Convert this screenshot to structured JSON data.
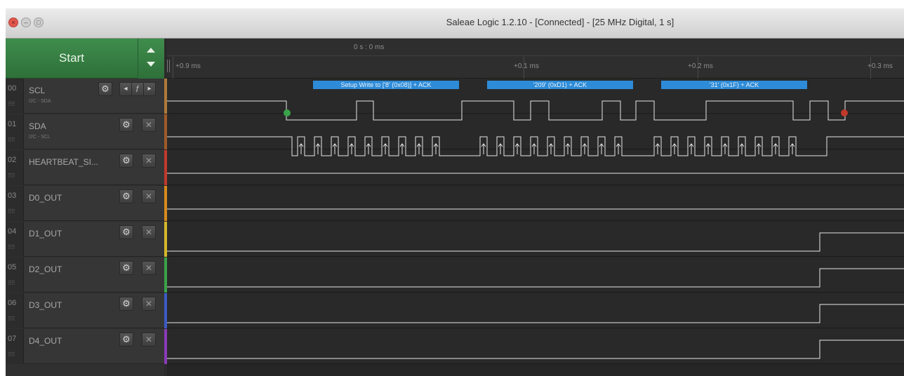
{
  "window": {
    "title": "Saleae Logic 1.2.10 - [Connected] - [25 MHz Digital, 1 s]",
    "close_glyph": "×",
    "min_glyph": "–",
    "zoom_glyph": "□"
  },
  "panel": {
    "start_label": "Start",
    "channels": [
      {
        "num": "00",
        "name": "SCL",
        "sub": "I2C - SDA",
        "color": "#b07a3a",
        "nav": [
          "◂",
          "ƒ",
          "▸"
        ]
      },
      {
        "num": "01",
        "name": "SDA",
        "sub": "I2C - SCL",
        "color": "#a05a28"
      },
      {
        "num": "02",
        "name": "HEARTBEAT_SI...",
        "sub": "",
        "color": "#c0392b"
      },
      {
        "num": "03",
        "name": "D0_OUT",
        "sub": "",
        "color": "#d98a1c"
      },
      {
        "num": "04",
        "name": "D1_OUT",
        "sub": "",
        "color": "#d4b72a"
      },
      {
        "num": "05",
        "name": "D2_OUT",
        "sub": "",
        "color": "#3aa24a"
      },
      {
        "num": "06",
        "name": "D3_OUT",
        "sub": "",
        "color": "#3b5bc4"
      },
      {
        "num": "07",
        "name": "D4_OUT",
        "sub": "",
        "color": "#8a3bb8"
      }
    ],
    "gear_glyph": "⚙",
    "close_glyph": "✕",
    "grip_glyph": "⠿⠿"
  },
  "ruler": {
    "zero_label": "0 s : 0 ms",
    "ticks": [
      {
        "label": "+0.9 ms"
      },
      {
        "label": "+0.1 ms"
      },
      {
        "label": "+0.2 ms"
      },
      {
        "label": "+0.3 ms"
      }
    ]
  },
  "annotations": [
    {
      "text": "Setup Write to ['8' (0x08)] + ACK"
    },
    {
      "text": "'209' (0xD1) + ACK"
    },
    {
      "text": "'31' (0x1F) + ACK"
    }
  ],
  "colors": {
    "start_green": "#3f8d4d",
    "annotation_blue": "#2d8bd8",
    "signal": "#e6e6e6",
    "marker_start": "#3aa24a",
    "marker_end": "#c0392b"
  },
  "icons": [
    "gear-icon",
    "close-icon",
    "up-arrow-icon",
    "down-arrow-icon",
    "prev-edge-icon",
    "trigger-icon",
    "next-edge-icon",
    "grip-icon"
  ]
}
